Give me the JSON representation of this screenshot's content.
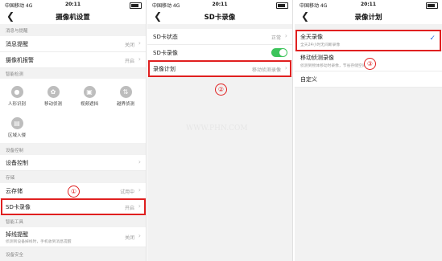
{
  "status": {
    "carrier": "中国移动  4G",
    "time": "20:11"
  },
  "panel1": {
    "title": "摄像机设置",
    "sec_message": "消息与提醒",
    "msg_reminder": {
      "label": "消息提醒",
      "value": "关闭"
    },
    "camera_alarm": {
      "label": "摄像机报警",
      "value": "开启"
    },
    "sec_smart": "智能检测",
    "smart_icons": [
      {
        "label": "人形识别",
        "icon": "person-icon"
      },
      {
        "label": "移动侦测",
        "icon": "motion-icon"
      },
      {
        "label": "视频遮挡",
        "icon": "occlusion-icon"
      },
      {
        "label": "越界侦测",
        "icon": "boundary-icon"
      },
      {
        "label": "区域入侵",
        "icon": "region-icon"
      }
    ],
    "sec_device": "设备控制",
    "device_control": {
      "label": "设备控制"
    },
    "sec_storage": "存储",
    "cloud": {
      "label": "云存储",
      "value": "试用中"
    },
    "sd": {
      "label": "SD卡录像",
      "value": "开启"
    },
    "sec_tools": "智能工具",
    "dropline": {
      "label": "掉线提醒",
      "value": "关闭",
      "sub": "侦测到设备掉线时，手机收到消息提醒"
    },
    "sec_security": "设备安全",
    "marker": "①"
  },
  "panel2": {
    "title": "SD卡录像",
    "sd_status": {
      "label": "SD卡状态",
      "value": "正常"
    },
    "sd_record": {
      "label": "SD卡录像"
    },
    "plan": {
      "label": "录像计划",
      "value": "移动侦测录像"
    },
    "marker": "②",
    "watermark": "WWW.PHN.COM"
  },
  "panel3": {
    "title": "录像计划",
    "allday": {
      "label": "全天录像",
      "sub": "全天24小时无间断录像"
    },
    "motion": {
      "label": "移动侦测录像",
      "sub": "侦测到物体移动时录像，节省存储空间"
    },
    "custom": {
      "label": "自定义"
    },
    "marker": "③"
  },
  "colors": {
    "accent": "#e02020",
    "toggle_on": "#3cc45b",
    "check": "#2a6ee8"
  }
}
